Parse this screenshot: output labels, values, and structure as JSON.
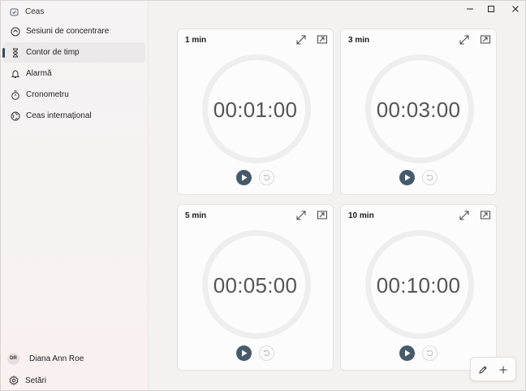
{
  "app": {
    "title": "Ceas"
  },
  "nav": {
    "items": [
      {
        "label": "Sesiuni de concentrare",
        "icon": "focus-icon"
      },
      {
        "label": "Contor de timp",
        "icon": "hourglass-icon",
        "active": true
      },
      {
        "label": "Alarmă",
        "icon": "bell-icon"
      },
      {
        "label": "Cronometru",
        "icon": "stopwatch-icon"
      },
      {
        "label": "Ceas internațional",
        "icon": "globe-icon"
      }
    ]
  },
  "profile": {
    "initials": "DR",
    "name": "Diana Ann Roe"
  },
  "settings": {
    "label": "Setări"
  },
  "timers": [
    {
      "title": "1 min",
      "time": "00:01:00"
    },
    {
      "title": "3 min",
      "time": "00:03:00"
    },
    {
      "title": "5 min",
      "time": "00:05:00"
    },
    {
      "title": "10 min",
      "time": "00:10:00"
    }
  ],
  "colors": {
    "accent": "#475a6b",
    "ring": "#efeeee"
  }
}
